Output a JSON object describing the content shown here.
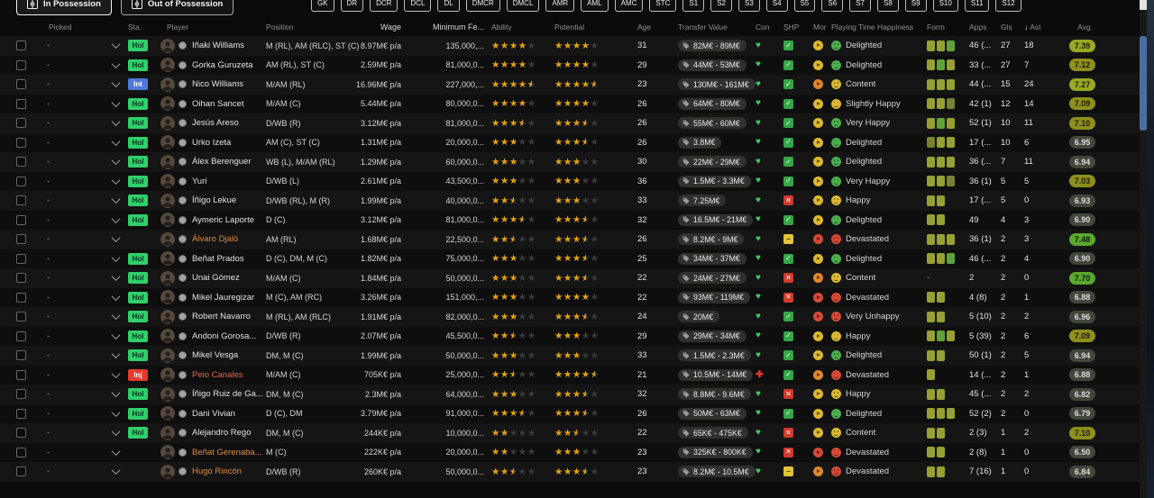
{
  "toolbar": {
    "tabs": [
      {
        "label": "In Possession",
        "active": true,
        "icon": "pitch-icon"
      },
      {
        "label": "Out of Possession",
        "active": false,
        "icon": "pitch-icon"
      }
    ],
    "position_filters": [
      "GK",
      "DR",
      "DCR",
      "DCL",
      "DL",
      "DMCR",
      "DMCL",
      "AMR",
      "AML",
      "AMC",
      "STC",
      "S1",
      "S2",
      "S3",
      "S4",
      "S5",
      "S6",
      "S7",
      "S8",
      "S9",
      "S10",
      "S11",
      "S12"
    ]
  },
  "table": {
    "columns": [
      {
        "key": "picked",
        "label": "Picked"
      },
      {
        "key": "sta",
        "label": "Sta."
      },
      {
        "key": "player",
        "label": "Player"
      },
      {
        "key": "position",
        "label": "Position"
      },
      {
        "key": "wage",
        "label": "Wage"
      },
      {
        "key": "minfee",
        "label": "Minimum Fe..."
      },
      {
        "key": "ability",
        "label": "Ability"
      },
      {
        "key": "potential",
        "label": "Potential"
      },
      {
        "key": "age",
        "label": "Age"
      },
      {
        "key": "value",
        "label": "Transfer Value"
      },
      {
        "key": "con",
        "label": "Con"
      },
      {
        "key": "shp",
        "label": "SHP"
      },
      {
        "key": "mor",
        "label": "Mor"
      },
      {
        "key": "happiness",
        "label": "Playing Time Happiness"
      },
      {
        "key": "form",
        "label": "Form"
      },
      {
        "key": "apps",
        "label": "Apps"
      },
      {
        "key": "gls",
        "label": "Gls"
      },
      {
        "key": "ast",
        "label": "Ast",
        "sorted": "desc"
      },
      {
        "key": "avg",
        "label": "Avg."
      }
    ],
    "rows": [
      {
        "picked": "-",
        "status": "Hol",
        "name": "Iñaki Williams",
        "name_color": "default",
        "position": "M (RL), AM (RLC), ST (C)",
        "wage": "8.97M€ p/a",
        "min_fee": "135,000,...",
        "ability": 4,
        "potential": 4,
        "age": "31",
        "value": "82M€ - 89M€",
        "con": "ok",
        "shp": "check",
        "mor": "yellow",
        "happiness": "Delighted",
        "happy_icon": "green",
        "form": [
          "o",
          "o",
          "g"
        ],
        "apps": "46 (...",
        "gls": "27",
        "ast": "18",
        "avg": "7.39",
        "avg_tier": "yellowgreen"
      },
      {
        "picked": "-",
        "status": "Hol",
        "name": "Gorka Guruzeta",
        "name_color": "default",
        "position": "AM (RL), ST (C)",
        "wage": "2.59M€ p/a",
        "min_fee": "81,000,0...",
        "ability": 4,
        "potential": 4,
        "age": "29",
        "value": "44M€ - 53M€",
        "con": "ok",
        "shp": "check",
        "mor": "yellow",
        "happiness": "Delighted",
        "happy_icon": "green",
        "form": [
          "o",
          "g",
          "o"
        ],
        "apps": "33 (...",
        "gls": "27",
        "ast": "7",
        "avg": "7.12",
        "avg_tier": "olive"
      },
      {
        "picked": "-",
        "status": "Int",
        "name": "Nico Williams",
        "name_color": "default",
        "position": "M/AM (RL)",
        "wage": "16.96M€ p/a",
        "min_fee": "227,000,...",
        "ability": 4.5,
        "potential": 4.5,
        "age": "23",
        "value": "130M€ - 161M€",
        "con": "ok",
        "shp": "check",
        "mor": "orange",
        "happiness": "Content",
        "happy_icon": "yellow",
        "form": [
          "o",
          "o",
          "o"
        ],
        "apps": "44 (...",
        "gls": "15",
        "ast": "24",
        "avg": "7.27",
        "avg_tier": "yellowgreen"
      },
      {
        "picked": "-",
        "status": "Hol",
        "name": "Oihan Sancet",
        "name_color": "default",
        "position": "M/AM (C)",
        "wage": "5.44M€ p/a",
        "min_fee": "80,000,0...",
        "ability": 4,
        "potential": 4,
        "age": "26",
        "value": "64M€ - 80M€",
        "con": "ok",
        "shp": "check",
        "mor": "yellow",
        "happiness": "Slightly Happy",
        "happy_icon": "yellow",
        "form": [
          "o",
          "o",
          "d"
        ],
        "apps": "42 (1)",
        "gls": "12",
        "ast": "14",
        "avg": "7.09",
        "avg_tier": "olive"
      },
      {
        "picked": "-",
        "status": "Hol",
        "name": "Jesús Areso",
        "name_color": "default",
        "position": "D/WB (R)",
        "wage": "3.12M€ p/a",
        "min_fee": "81,000,0...",
        "ability": 3.5,
        "potential": 3.5,
        "age": "26",
        "value": "55M€ - 60M€",
        "con": "ok",
        "shp": "check",
        "mor": "yellow",
        "happiness": "Very Happy",
        "happy_icon": "green",
        "form": [
          "o",
          "g",
          "o"
        ],
        "apps": "52 (1)",
        "gls": "10",
        "ast": "11",
        "avg": "7.10",
        "avg_tier": "olive"
      },
      {
        "picked": "-",
        "status": "Hol",
        "name": "Urko Izeta",
        "name_color": "default",
        "position": "AM (C), ST (C)",
        "wage": "1.31M€ p/a",
        "min_fee": "20,000,0...",
        "ability": 3,
        "potential": 3.5,
        "age": "26",
        "value": "3.8M€",
        "con": "ok",
        "shp": "check",
        "mor": "yellow",
        "happiness": "Delighted",
        "happy_icon": "green",
        "form": [
          "d",
          "o",
          "o"
        ],
        "apps": "17 (...",
        "gls": "10",
        "ast": "6",
        "avg": "6.95",
        "avg_tier": "gray"
      },
      {
        "picked": "-",
        "status": "Hol",
        "name": "Álex Berenguer",
        "name_color": "default",
        "position": "WB (L), M/AM (RL)",
        "wage": "1.29M€ p/a",
        "min_fee": "60,000,0...",
        "ability": 3,
        "potential": 3,
        "age": "30",
        "value": "22M€ - 29M€",
        "con": "ok",
        "shp": "check",
        "mor": "yellow",
        "happiness": "Delighted",
        "happy_icon": "green",
        "form": [
          "o",
          "o",
          "o"
        ],
        "apps": "36 (...",
        "gls": "7",
        "ast": "11",
        "avg": "6.94",
        "avg_tier": "gray"
      },
      {
        "picked": "-",
        "status": "Hol",
        "name": "Yuri",
        "name_color": "default",
        "position": "D/WB (L)",
        "wage": "2.61M€ p/a",
        "min_fee": "43,500,0...",
        "ability": 3,
        "potential": 3,
        "age": "36",
        "value": "1.5M€ - 3.3M€",
        "con": "ok",
        "shp": "check",
        "mor": "yellow",
        "happiness": "Very Happy",
        "happy_icon": "green",
        "form": [
          "o",
          "o",
          "d"
        ],
        "apps": "36 (1)",
        "gls": "5",
        "ast": "5",
        "avg": "7.03",
        "avg_tier": "olive"
      },
      {
        "picked": "-",
        "status": "Hol",
        "name": "Íñigo Lekue",
        "name_color": "default",
        "position": "D/WB (RL), M (R)",
        "wage": "1.99M€ p/a",
        "min_fee": "40,000,0...",
        "ability": 2.5,
        "potential": 3,
        "age": "33",
        "value": "7.25M€",
        "con": "ok",
        "shp": "cross",
        "mor": "yellow",
        "happiness": "Happy",
        "happy_icon": "yellow",
        "form": [
          "o",
          "o"
        ],
        "apps": "17 (...",
        "gls": "5",
        "ast": "0",
        "avg": "6.93",
        "avg_tier": "gray"
      },
      {
        "picked": "-",
        "status": "Hol",
        "name": "Aymeric Laporte",
        "name_color": "default",
        "position": "D (C)",
        "wage": "3.12M€ p/a",
        "min_fee": "81,000,0...",
        "ability": 3.5,
        "potential": 3.5,
        "age": "32",
        "value": "16.5M€ - 21M€",
        "con": "ok",
        "shp": "check",
        "mor": "yellow",
        "happiness": "Delighted",
        "happy_icon": "green",
        "form": [
          "o",
          "o"
        ],
        "apps": "49",
        "gls": "4",
        "ast": "3",
        "avg": "6.90",
        "avg_tier": "gray"
      },
      {
        "picked": "-",
        "status": "",
        "name": "Álvaro Djaló",
        "name_color": "orange",
        "position": "AM (RL)",
        "wage": "1.68M€ p/a",
        "min_fee": "22,500,0...",
        "ability": 2.5,
        "potential": 3.5,
        "age": "26",
        "value": "8.2M€ - 9M€",
        "con": "ok",
        "shp": "minus",
        "mor": "red",
        "happiness": "Devastated",
        "happy_icon": "red",
        "form": [
          "o",
          "o",
          "o"
        ],
        "apps": "36 (1)",
        "gls": "2",
        "ast": "3",
        "avg": "7.48",
        "avg_tier": "green"
      },
      {
        "picked": "-",
        "status": "Hol",
        "name": "Beñat Prados",
        "name_color": "default",
        "position": "D (C), DM, M (C)",
        "wage": "1.82M€ p/a",
        "min_fee": "75,000,0...",
        "ability": 3,
        "potential": 3.5,
        "age": "25",
        "value": "34M€ - 37M€",
        "con": "ok",
        "shp": "check",
        "mor": "yellow",
        "happiness": "Delighted",
        "happy_icon": "green",
        "form": [
          "o",
          "o",
          "g"
        ],
        "apps": "46 (...",
        "gls": "2",
        "ast": "4",
        "avg": "6.90",
        "avg_tier": "gray"
      },
      {
        "picked": "-",
        "status": "Hol",
        "name": "Unai Gómez",
        "name_color": "default",
        "position": "M/AM (C)",
        "wage": "1.84M€ p/a",
        "min_fee": "50,000,0...",
        "ability": 3,
        "potential": 3.5,
        "age": "22",
        "value": "24M€ - 27M€",
        "con": "ok",
        "shp": "cross",
        "mor": "orange",
        "happiness": "Content",
        "happy_icon": "yellow",
        "form": "-",
        "apps": "2",
        "gls": "2",
        "ast": "0",
        "avg": "7.70",
        "avg_tier": "green"
      },
      {
        "picked": "-",
        "status": "Hol",
        "name": "Mikel Jauregizar",
        "name_color": "default",
        "position": "M (C), AM (RC)",
        "wage": "3.26M€ p/a",
        "min_fee": "151,000,...",
        "ability": 3,
        "potential": 4,
        "age": "22",
        "value": "93M€ - 119M€",
        "con": "ok",
        "shp": "cross",
        "mor": "red",
        "happiness": "Devastated",
        "happy_icon": "red",
        "form": [
          "o",
          "o"
        ],
        "apps": "4 (8)",
        "gls": "2",
        "ast": "1",
        "avg": "6.88",
        "avg_tier": "gray"
      },
      {
        "picked": "-",
        "status": "Hol",
        "name": "Robert Navarro",
        "name_color": "default",
        "position": "M (RL), AM (RLC)",
        "wage": "1.91M€ p/a",
        "min_fee": "82,000,0...",
        "ability": 3,
        "potential": 3.5,
        "age": "24",
        "value": "20M€",
        "con": "ok",
        "shp": "check",
        "mor": "red",
        "happiness": "Very Unhappy",
        "happy_icon": "red",
        "form": [
          "o",
          "o"
        ],
        "apps": "5 (10)",
        "gls": "2",
        "ast": "2",
        "avg": "6.96",
        "avg_tier": "gray"
      },
      {
        "picked": "-",
        "status": "Hol",
        "name": "Andoni Gorosa...",
        "name_color": "default",
        "position": "D/WB (R)",
        "wage": "2.07M€ p/a",
        "min_fee": "45,500,0...",
        "ability": 2.5,
        "potential": 3,
        "age": "29",
        "value": "29M€ - 34M€",
        "con": "ok",
        "shp": "check",
        "mor": "yellow",
        "happiness": "Happy",
        "happy_icon": "yellow",
        "form": [
          "o",
          "g",
          "o"
        ],
        "apps": "5 (39)",
        "gls": "2",
        "ast": "6",
        "avg": "7.09",
        "avg_tier": "olive"
      },
      {
        "picked": "-",
        "status": "Hol",
        "name": "Mikel Vesga",
        "name_color": "default",
        "position": "DM, M (C)",
        "wage": "1.99M€ p/a",
        "min_fee": "50,000,0...",
        "ability": 3,
        "potential": 3,
        "age": "33",
        "value": "1.5M€ - 2.3M€",
        "con": "ok",
        "shp": "check",
        "mor": "yellow",
        "happiness": "Delighted",
        "happy_icon": "green",
        "form": [
          "o",
          "o"
        ],
        "apps": "50 (1)",
        "gls": "2",
        "ast": "5",
        "avg": "6.94",
        "avg_tier": "gray"
      },
      {
        "picked": "-",
        "status": "Inj",
        "name": "Peio Canales",
        "name_color": "injured",
        "position": "M/AM (C)",
        "wage": "705K€ p/a",
        "min_fee": "25,000,0...",
        "ability": 2.5,
        "potential": 4.5,
        "age": "21",
        "value": "10.5M€ - 14M€",
        "con": "inj",
        "shp": "check",
        "mor": "orange",
        "happiness": "Devastated",
        "happy_icon": "red",
        "form": [
          "o"
        ],
        "apps": "14 (...",
        "gls": "2",
        "ast": "1",
        "avg": "6.88",
        "avg_tier": "gray"
      },
      {
        "picked": "-",
        "status": "Hol",
        "name": "Íñigo Ruiz de Ga...",
        "name_color": "default",
        "position": "DM, M (C)",
        "wage": "2.3M€ p/a",
        "min_fee": "64,000,0...",
        "ability": 3,
        "potential": 3.5,
        "age": "32",
        "value": "8.8M€ - 9.6M€",
        "con": "ok",
        "shp": "cross",
        "mor": "yellow",
        "happiness": "Happy",
        "happy_icon": "yellow",
        "form": [
          "o",
          "o"
        ],
        "apps": "45 (...",
        "gls": "2",
        "ast": "2",
        "avg": "6.82",
        "avg_tier": "gray"
      },
      {
        "picked": "-",
        "status": "Hol",
        "name": "Dani Vivian",
        "name_color": "default",
        "position": "D (C), DM",
        "wage": "3.79M€ p/a",
        "min_fee": "91,000,0...",
        "ability": 3.5,
        "potential": 3.5,
        "age": "26",
        "value": "50M€ - 63M€",
        "con": "ok",
        "shp": "check",
        "mor": "yellow",
        "happiness": "Delighted",
        "happy_icon": "green",
        "form": [
          "o",
          "o",
          "o"
        ],
        "apps": "52 (2)",
        "gls": "2",
        "ast": "0",
        "avg": "6.79",
        "avg_tier": "gray"
      },
      {
        "picked": "-",
        "status": "Hol",
        "name": "Alejandro Rego",
        "name_color": "default",
        "position": "DM, M (C)",
        "wage": "244K€ p/a",
        "min_fee": "10,000,0...",
        "ability": 2,
        "potential": 2.5,
        "age": "22",
        "value": "65K€ - 475K€",
        "con": "ok",
        "shp": "cross",
        "mor": "yellow",
        "happiness": "Content",
        "happy_icon": "yellow",
        "form": [
          "o",
          "o"
        ],
        "apps": "2 (3)",
        "gls": "1",
        "ast": "2",
        "avg": "7.10",
        "avg_tier": "olive"
      },
      {
        "picked": "-",
        "status": "",
        "name": "Beñat Gerenaba...",
        "name_color": "orange",
        "position": "M (C)",
        "wage": "222K€ p/a",
        "min_fee": "20,000,0...",
        "ability": 2,
        "potential": 3,
        "age": "23",
        "value": "325K€ - 800K€",
        "con": "ok",
        "shp": "cross",
        "mor": "red",
        "happiness": "Devastated",
        "happy_icon": "red",
        "form": [
          "o",
          "o"
        ],
        "apps": "2 (8)",
        "gls": "1",
        "ast": "0",
        "avg": "6.50",
        "avg_tier": "gray"
      },
      {
        "picked": "-",
        "status": "",
        "name": "Hugo Rincón",
        "name_color": "orange",
        "position": "D/WB (R)",
        "wage": "260K€ p/a",
        "min_fee": "50,000,0...",
        "ability": 2.5,
        "potential": 3.5,
        "age": "23",
        "value": "8.2M€ - 10.5M€",
        "con": "ok",
        "shp": "minus",
        "mor": "orange",
        "happiness": "Devastated",
        "happy_icon": "red",
        "form": [
          "o",
          "o"
        ],
        "apps": "7 (16)",
        "gls": "1",
        "ast": "0",
        "avg": "6.84",
        "avg_tier": "gray"
      }
    ]
  },
  "palette": {
    "star_filled": "#e3a418",
    "star_empty": "#3c3c3c",
    "status": {
      "Hol": {
        "bg": "#2fd06b",
        "text": "#07331a"
      },
      "Int": {
        "bg": "#4f79d8",
        "text": "#ffffff"
      },
      "Inj": {
        "bg": "#e8392b",
        "text": "#ffffff"
      }
    },
    "shp": {
      "check": "#35a649",
      "cross": "#d13a2e",
      "minus": "#e3c339"
    },
    "mor": {
      "yellow": "#dcb932",
      "orange": "#dd872f",
      "red": "#d64937",
      "green": "#4caf50"
    },
    "happy": {
      "green": "#4cae4f",
      "yellow": "#dcb932",
      "red": "#d64937"
    },
    "form_colors": {
      "o": "#97a033",
      "g": "#5fa337",
      "y": "#b9bf3e",
      "d": "#79822e"
    },
    "avg_tiers": {
      "green": {
        "bg": "#5ba72f",
        "text": "#0f2005"
      },
      "yellowgreen": {
        "bg": "#9aa822",
        "text": "#1d2004"
      },
      "olive": {
        "bg": "#8e8f1e",
        "text": "#202004"
      },
      "gray": {
        "bg": "#43463c",
        "text": "#dcdcdc"
      }
    },
    "con_ok": "#3fca6b",
    "con_inj": "#e8392b",
    "name_orange": "#de8b3c",
    "name_injured": "#e0664d",
    "scrollbar_thumb": "#4a6f9e"
  }
}
